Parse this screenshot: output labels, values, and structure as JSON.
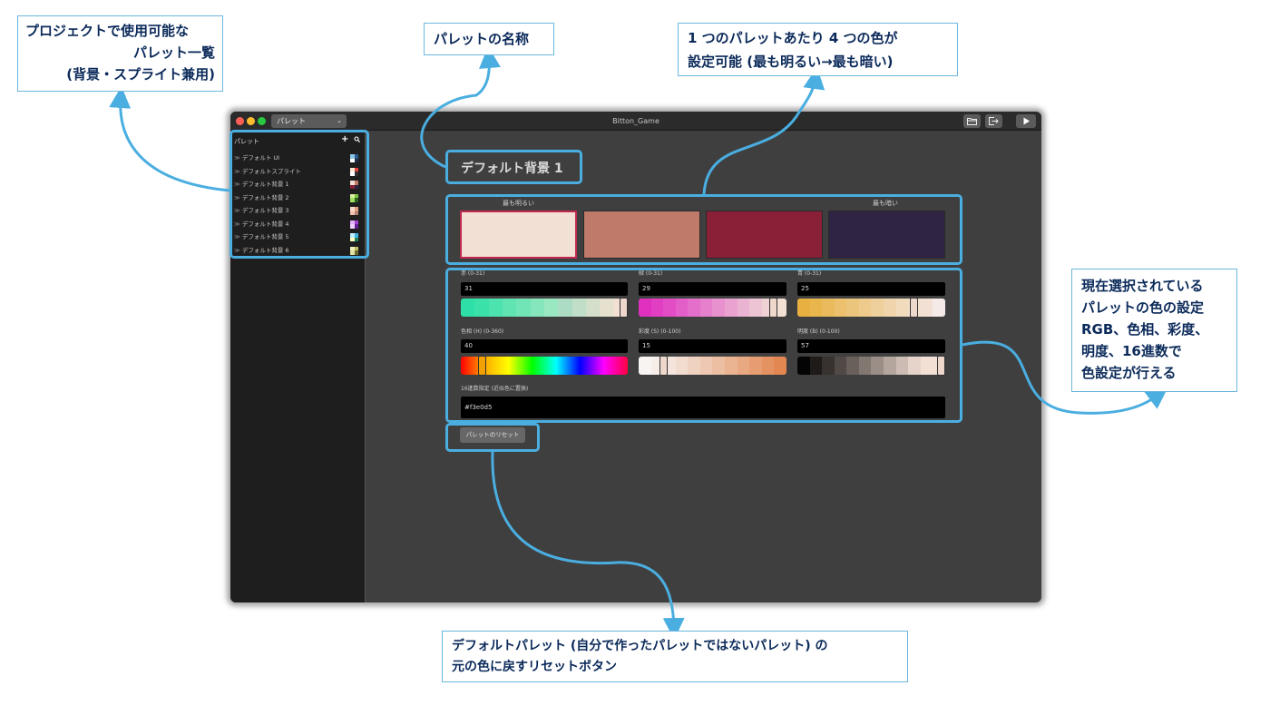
{
  "window": {
    "title": "Bitton_Game",
    "selector": "パレット"
  },
  "sidebar": {
    "header": "パレット",
    "add_label": "+",
    "items": [
      {
        "label": "デフォルト UI",
        "colors": [
          "#8fc7e8",
          "#2a5a8a",
          "#ffffff",
          "#1e2c4a"
        ]
      },
      {
        "label": "デフォルトスプライト",
        "colors": [
          "#ffe8d0",
          "#e04040",
          "#ffffff",
          "#303030"
        ]
      },
      {
        "label": "デフォルト背景 1",
        "colors": [
          "#f3e0d5",
          "#c07a6a",
          "#8a2038",
          "#302444"
        ]
      },
      {
        "label": "デフォルト背景 2",
        "colors": [
          "#d8f0a0",
          "#80c040",
          "#a0e060",
          "#306020"
        ]
      },
      {
        "label": "デフォルト背景 3",
        "colors": [
          "#f8d8c8",
          "#e0a080",
          "#f0c0b0",
          "#b08070"
        ]
      },
      {
        "label": "デフォルト背景 4",
        "colors": [
          "#e0b0f8",
          "#a040d0",
          "#f0d0ff",
          "#602090"
        ]
      },
      {
        "label": "デフォルト背景 5",
        "colors": [
          "#c0f0ff",
          "#40b0e0",
          "#ffffc0",
          "#208060"
        ]
      },
      {
        "label": "デフォルト背景 6",
        "colors": [
          "#f0f0c0",
          "#c0c060",
          "#e0e0a0",
          "#6a6a30"
        ]
      }
    ]
  },
  "palette": {
    "name": "デフォルト背景 1",
    "lightest_label": "最も明るい",
    "darkest_label": "最も暗い",
    "swatches": [
      "#f3e0d5",
      "#c07a6a",
      "#8a2038",
      "#302444"
    ],
    "selected_index": 0
  },
  "fields": {
    "red": {
      "label": "赤 (0-31)",
      "value": "31",
      "level": 1.0
    },
    "green": {
      "label": "緑 (0-31)",
      "value": "29",
      "level": 0.935
    },
    "blue": {
      "label": "青 (0-31)",
      "value": "25",
      "level": 0.806
    },
    "hue": {
      "label": "色相 (H) (0-360)",
      "value": "40",
      "level": 0.111
    },
    "saturation": {
      "label": "彩度 (S) (0-100)",
      "value": "15",
      "level": 0.15
    },
    "brightness": {
      "label": "明度 (B) (0-100)",
      "value": "57",
      "level": 1.0
    },
    "hex": {
      "label": "16進数指定 (近似色に置換)",
      "value": "#f3e0d5"
    }
  },
  "reset_button": "パレットのリセット",
  "annotations": {
    "list": [
      "プロジェクトで使用可能な",
      "パレット一覧",
      "(背景・スプライト兼用)"
    ],
    "name": [
      "パレットの名称"
    ],
    "colors": [
      "1 つのパレットあたり 4 つの色が",
      "設定可能 (最も明るい→最も暗い)"
    ],
    "settings": [
      "現在選択されている",
      "パレットの色の設定",
      "RGB、色相、彩度、",
      "明度、16進数で",
      "色設定が行える"
    ],
    "reset": [
      "デフォルトパレット (自分で作ったパレットではないパレット) の",
      "元の色に戻すリセットボタン"
    ]
  },
  "accent_colors": {
    "annotation": "#4aaee0",
    "callout_text": "#0b2a5a",
    "selection": "#c1294f"
  }
}
